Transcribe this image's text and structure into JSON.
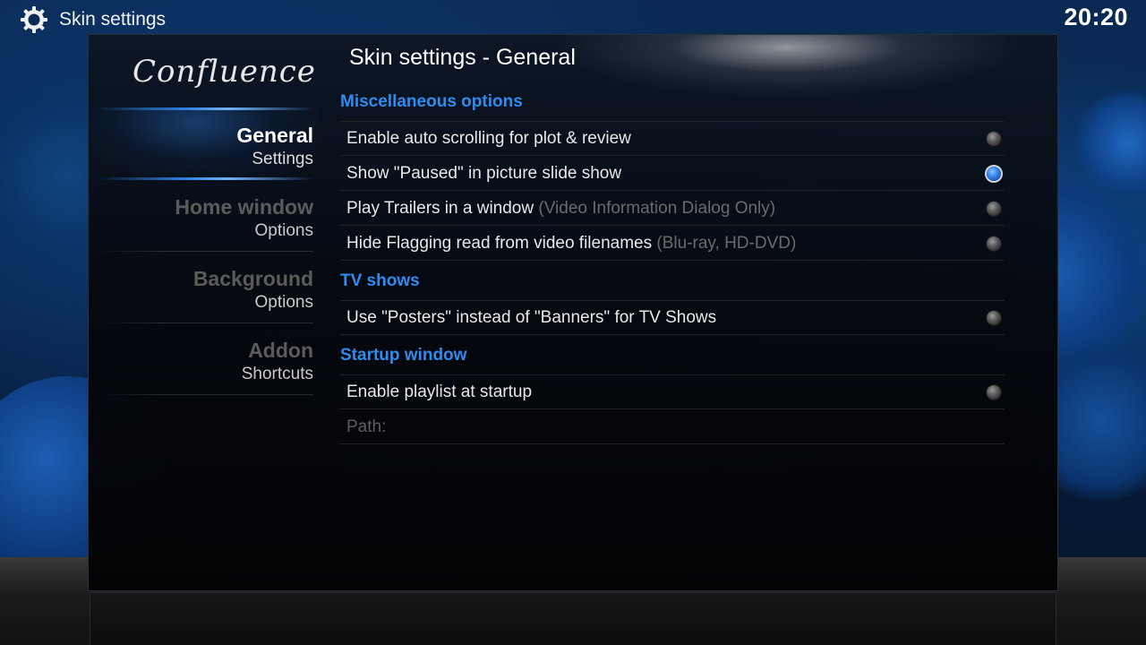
{
  "header": {
    "title": "Skin settings",
    "icon": "gear-icon",
    "clock": "20:20"
  },
  "logo": {
    "text": "Confluence"
  },
  "menu": {
    "items": [
      {
        "title": "General",
        "subtitle": "Settings",
        "active": true
      },
      {
        "title": "Home window",
        "subtitle": "Options",
        "active": false
      },
      {
        "title": "Background",
        "subtitle": "Options",
        "active": false
      },
      {
        "title": "Addon",
        "subtitle": "Shortcuts",
        "active": false
      }
    ]
  },
  "main": {
    "title": "Skin settings - General",
    "sections": [
      {
        "header": "Miscellaneous options",
        "rows": [
          {
            "label": "Enable auto scrolling for plot & review",
            "hint": "",
            "checked": false
          },
          {
            "label": "Show \"Paused\" in picture slide show",
            "hint": "",
            "checked": true
          },
          {
            "label": "Play Trailers in a window ",
            "hint": "(Video Information Dialog Only)",
            "checked": false
          },
          {
            "label": "Hide Flagging read from video filenames ",
            "hint": "(Blu-ray, HD-DVD)",
            "checked": false
          }
        ]
      },
      {
        "header": "TV shows",
        "rows": [
          {
            "label": "Use \"Posters\" instead of \"Banners\" for TV Shows",
            "hint": "",
            "checked": false
          }
        ]
      },
      {
        "header": "Startup window",
        "rows": [
          {
            "label": "Enable playlist at startup",
            "hint": "",
            "checked": false
          },
          {
            "label": "Path:",
            "hint": "",
            "disabled": true
          }
        ]
      }
    ]
  },
  "colors": {
    "section_header": "#2e8cf0",
    "radio_on": "#2f7fe6",
    "hint_text": "#6a6a6a"
  }
}
